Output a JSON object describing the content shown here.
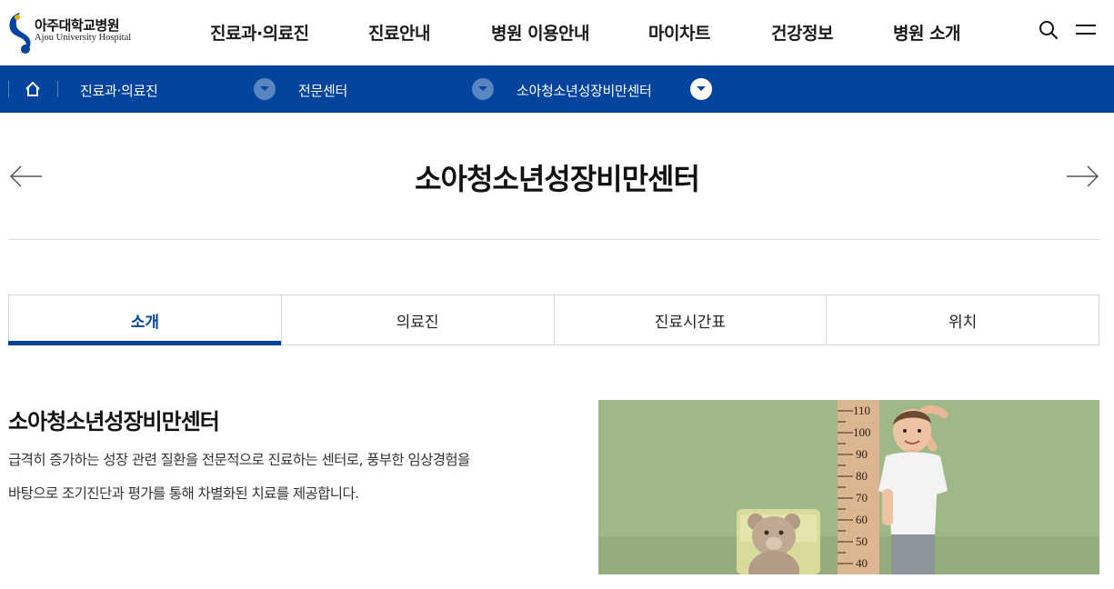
{
  "header": {
    "logo_ko": "아주대학교병원",
    "logo_en": "Ajou University Hospital",
    "nav": [
      "진료과·의료진",
      "진료안내",
      "병원 이용안내",
      "마이차트",
      "건강정보",
      "병원 소개"
    ],
    "icons": [
      "search-icon",
      "menu-icon"
    ]
  },
  "breadcrumb": {
    "home_icon": "home-icon",
    "items": [
      "진료과·의료진",
      "전문센터",
      "소아청소년성장비만센터"
    ]
  },
  "page": {
    "title": "소아청소년성장비만센터",
    "prev_icon": "arrow-left-icon",
    "next_icon": "arrow-right-icon"
  },
  "tabs": [
    {
      "label": "소개",
      "active": true
    },
    {
      "label": "의료진",
      "active": false
    },
    {
      "label": "진료시간표",
      "active": false
    },
    {
      "label": "위치",
      "active": false
    }
  ],
  "intro": {
    "title": "소아청소년성장비만센터",
    "lines": [
      "급격히 증가하는 성장 관련 질환을 전문적으로 진료하는 센터로, 풍부한 임상경험을",
      "바탕으로 조기진단과 평가를 통해 차별화된 치료를 제공합니다."
    ]
  },
  "hero": {
    "ruler_marks": [
      "110",
      "100",
      "90",
      "80",
      "70",
      "60",
      "50",
      "40"
    ]
  },
  "colors": {
    "brand_blue": "#00449e",
    "hero_bg": "#9fb887"
  }
}
